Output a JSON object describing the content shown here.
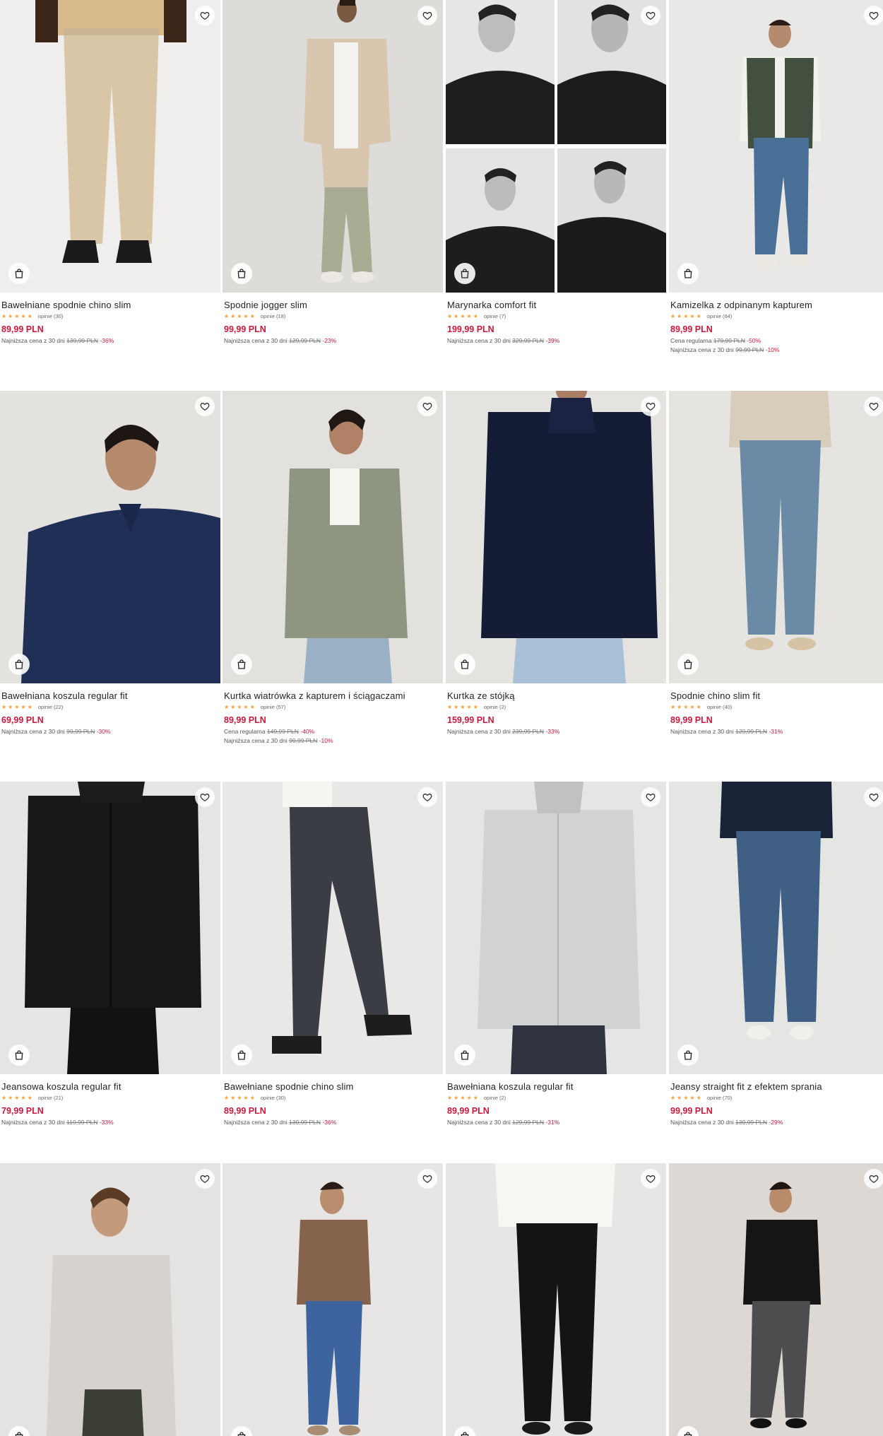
{
  "colors": {
    "price": "#c8193c",
    "star": "#f1a23b"
  },
  "icons": {
    "favorite": "heart-icon",
    "cart": "shopping-bag-icon"
  },
  "products": [
    {
      "name": "Bawełniane spodnie chino slim",
      "stars": "★★★★★",
      "reviews": "opinie (30)",
      "price": "89,99 PLN",
      "notes": [
        {
          "label": "Najniższa cena z 30 dni",
          "old": "139,99 PLN",
          "disc": "-36%"
        }
      ]
    },
    {
      "name": "Spodnie jogger slim",
      "stars": "★★★★★",
      "reviews": "opinie (18)",
      "price": "99,99 PLN",
      "notes": [
        {
          "label": "Najniższa cena z 30 dni",
          "old": "129,99 PLN",
          "disc": "-23%"
        }
      ]
    },
    {
      "name": "Marynarka comfort fit",
      "stars": "★★★★★",
      "reviews": "opinie (7)",
      "price": "199,99 PLN",
      "notes": [
        {
          "label": "Najniższa cena z 30 dni",
          "old": "329,99 PLN",
          "disc": "-39%"
        }
      ]
    },
    {
      "name": "Kamizelka z odpinanym kapturem",
      "stars": "★★★★★",
      "reviews": "opinie (64)",
      "price": "89,99 PLN",
      "notes": [
        {
          "label": "Cena regularna",
          "old": "179,99 PLN",
          "disc": "-50%"
        },
        {
          "label": "Najniższa cena z 30 dni",
          "old": "99,99 PLN",
          "disc": "-10%"
        }
      ]
    },
    {
      "name": "Bawełniana koszula regular fit",
      "stars": "★★★★★",
      "reviews": "opinie (22)",
      "price": "69,99 PLN",
      "notes": [
        {
          "label": "Najniższa cena z 30 dni",
          "old": "99,99 PLN",
          "disc": "-30%"
        }
      ]
    },
    {
      "name": "Kurtka wiatrówka z kapturem i ściągaczami",
      "stars": "★★★★★",
      "reviews": "opinie (57)",
      "price": "89,99 PLN",
      "notes": [
        {
          "label": "Cena regularna",
          "old": "149,99 PLN",
          "disc": "-40%"
        },
        {
          "label": "Najniższa cena z 30 dni",
          "old": "99,99 PLN",
          "disc": "-10%"
        }
      ]
    },
    {
      "name": "Kurtka ze stójką",
      "stars": "★★★★★",
      "reviews": "opinie (2)",
      "price": "159,99 PLN",
      "notes": [
        {
          "label": "Najniższa cena z 30 dni",
          "old": "239,99 PLN",
          "disc": "-33%"
        }
      ]
    },
    {
      "name": "Spodnie chino slim fit",
      "stars": "★★★★★",
      "reviews": "opinie (40)",
      "price": "89,99 PLN",
      "notes": [
        {
          "label": "Najniższa cena z 30 dni",
          "old": "129,99 PLN",
          "disc": "-31%"
        }
      ]
    },
    {
      "name": "Jeansowa koszula regular fit",
      "stars": "★★★★★",
      "reviews": "opinie (21)",
      "price": "79,99 PLN",
      "notes": [
        {
          "label": "Najniższa cena z 30 dni",
          "old": "119,99 PLN",
          "disc": "-33%"
        }
      ]
    },
    {
      "name": "Bawełniane spodnie chino slim",
      "stars": "★★★★★",
      "reviews": "opinie (30)",
      "price": "89,99 PLN",
      "notes": [
        {
          "label": "Najniższa cena z 30 dni",
          "old": "139,99 PLN",
          "disc": "-36%"
        }
      ]
    },
    {
      "name": "Bawełniana koszula regular fit",
      "stars": "★★★★★",
      "reviews": "opinie (2)",
      "price": "89,99 PLN",
      "notes": [
        {
          "label": "Najniższa cena z 30 dni",
          "old": "129,99 PLN",
          "disc": "-31%"
        }
      ]
    },
    {
      "name": "Jeansy straight fit z efektem sprania",
      "stars": "★★★★★",
      "reviews": "opinie (70)",
      "price": "99,99 PLN",
      "notes": [
        {
          "label": "Najniższa cena z 30 dni",
          "old": "139,99 PLN",
          "disc": "-29%"
        }
      ]
    },
    {
      "name": "",
      "stars": "",
      "reviews": "",
      "price": "",
      "notes": []
    },
    {
      "name": "",
      "stars": "",
      "reviews": "",
      "price": "",
      "notes": []
    },
    {
      "name": "",
      "stars": "",
      "reviews": "",
      "price": "",
      "notes": []
    },
    {
      "name": "",
      "stars": "",
      "reviews": "",
      "price": "",
      "notes": []
    }
  ]
}
